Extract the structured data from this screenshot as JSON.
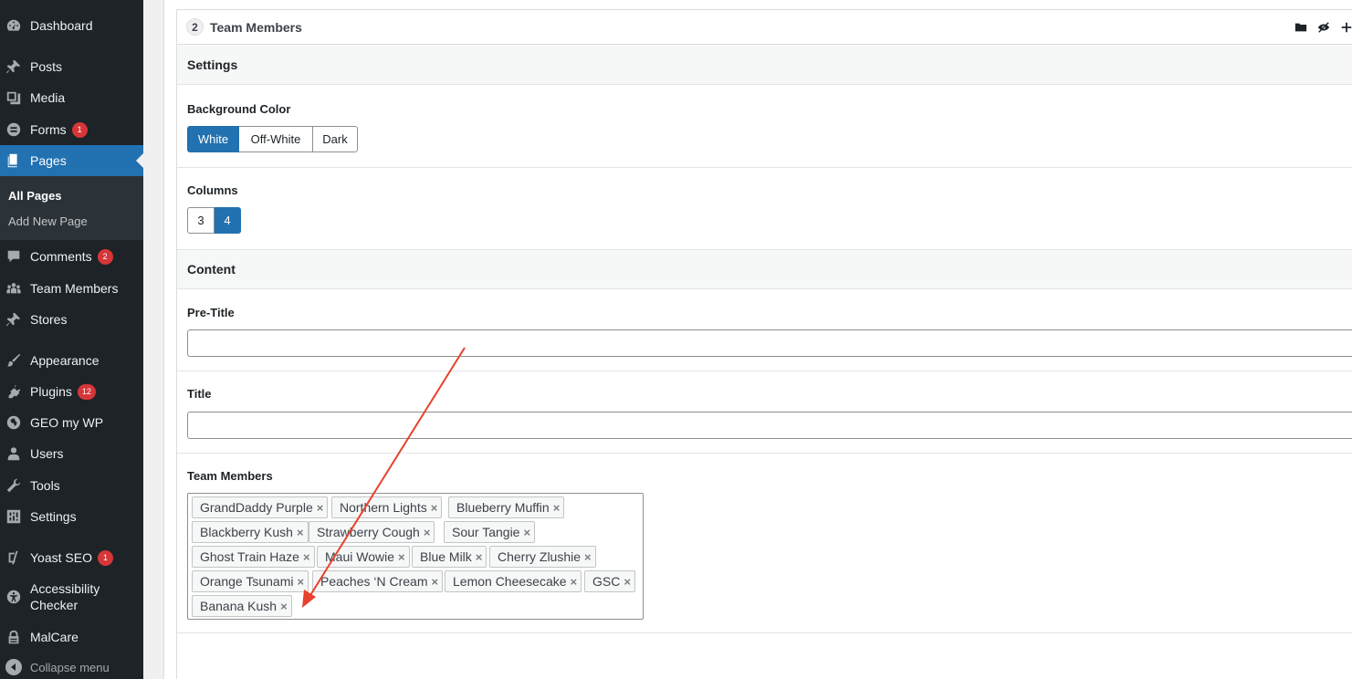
{
  "sidebar": {
    "items": [
      {
        "label": "Dashboard",
        "icon": "dashboard-icon"
      },
      {
        "label": "Posts",
        "icon": "pin-icon"
      },
      {
        "label": "Media",
        "icon": "media-icon"
      },
      {
        "label": "Forms",
        "icon": "forms-icon",
        "badge": "1"
      },
      {
        "label": "Pages",
        "icon": "pages-icon",
        "current": true
      },
      {
        "label": "Comments",
        "icon": "comment-icon",
        "badge": "2"
      },
      {
        "label": "Team Members",
        "icon": "groups-icon"
      },
      {
        "label": "Stores",
        "icon": "pin-icon"
      },
      {
        "label": "Appearance",
        "icon": "paintbrush-icon"
      },
      {
        "label": "Plugins",
        "icon": "plugin-icon",
        "badge": "12"
      },
      {
        "label": "GEO my WP",
        "icon": "globe-icon"
      },
      {
        "label": "Users",
        "icon": "users-icon"
      },
      {
        "label": "Tools",
        "icon": "wrench-icon"
      },
      {
        "label": "Settings",
        "icon": "settings-icon"
      },
      {
        "label": "Yoast SEO",
        "icon": "yoast-icon",
        "badge": "1"
      },
      {
        "label": "Accessibility Checker",
        "icon": "accessibility-icon"
      },
      {
        "label": "MalCare",
        "icon": "malcare-icon"
      }
    ],
    "submenu": [
      "All Pages",
      "Add New Page"
    ],
    "collapse_label": "Collapse menu"
  },
  "panel": {
    "number": "2",
    "title": "Team Members",
    "settings_heading": "Settings",
    "background_color": {
      "label": "Background Color",
      "options": [
        "White",
        "Off-White",
        "Dark"
      ],
      "selected": "White"
    },
    "columns": {
      "label": "Columns",
      "options": [
        "3",
        "4"
      ],
      "selected": "4"
    },
    "content_heading": "Content",
    "pre_title": {
      "label": "Pre-Title",
      "value": ""
    },
    "title_field": {
      "label": "Title",
      "value": ""
    },
    "team_members": {
      "label": "Team Members",
      "remove_glyph": "×",
      "tags": [
        "GrandDaddy Purple",
        "Northern Lights",
        "Blueberry Muffin",
        "Blackberry Kush",
        "Strawberry Cough",
        "Sour Tangie",
        "Ghost Train Haze",
        "Maui Wowie",
        "Blue Milk",
        "Cherry Zlushie",
        "Orange Tsunami",
        "Peaches ‘N Cream",
        "Lemon Cheesecake",
        "GSC",
        "Banana Kush"
      ]
    }
  },
  "colors": {
    "sidebar_bg": "#1d2327",
    "accent": "#2271b1",
    "badge": "#d63638",
    "arrow": "#e8412c"
  }
}
